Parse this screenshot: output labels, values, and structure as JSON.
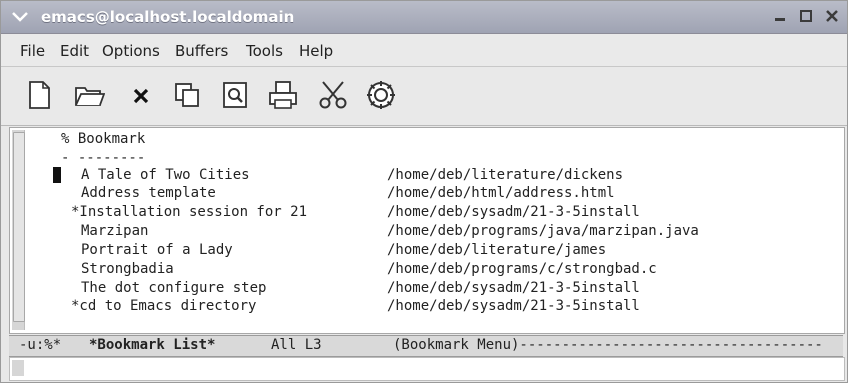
{
  "window": {
    "title": "emacs@localhost.localdomain"
  },
  "menu": {
    "items": [
      "File",
      "Edit",
      "Options",
      "Buffers",
      "Tools",
      "Help"
    ]
  },
  "toolbar": {
    "icons": [
      "new-file-icon",
      "open-folder-icon",
      "close-icon",
      "copy-icon",
      "search-icon",
      "print-icon",
      "cut-icon",
      "gear-icon"
    ]
  },
  "buffer": {
    "header": "% Bookmark",
    "separator": "- --------",
    "bookmarks": [
      {
        "name": "A Tale of Two Cities",
        "file": "/home/deb/literature/dickens"
      },
      {
        "name": "Address template",
        "file": "/home/deb/html/address.html"
      },
      {
        "name": "*Installation session for 21",
        "file": "/home/deb/sysadm/21-3-5install"
      },
      {
        "name": "Marzipan",
        "file": "/home/deb/programs/java/marzipan.java"
      },
      {
        "name": "Portrait of a Lady",
        "file": "/home/deb/literature/james"
      },
      {
        "name": "Strongbadia",
        "file": "/home/deb/programs/c/strongbad.c"
      },
      {
        "name": "The dot configure step",
        "file": "/home/deb/sysadm/21-3-5install"
      },
      {
        "name": "*cd to Emacs directory",
        "file": "/home/deb/sysadm/21-3-5install"
      }
    ]
  },
  "modeline": {
    "status": "-u:%*",
    "buffer_name": "*Bookmark List*",
    "position": "All L3",
    "mode": "(Bookmark Menu)------------------------------------"
  },
  "colors": {
    "titlebar": "#a8abba",
    "background": "#e9e9e9",
    "buffer": "#ffffff"
  }
}
